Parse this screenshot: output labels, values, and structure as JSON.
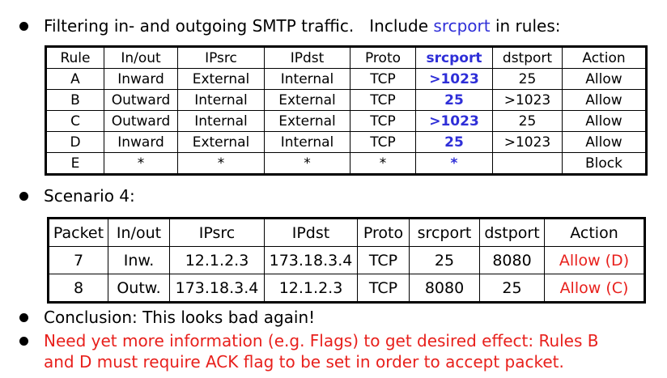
{
  "heading": {
    "text_before": "Filtering in- and outgoing SMTP traffic.   Include ",
    "accent": "srcport",
    "text_after": " in rules:"
  },
  "rules_table": {
    "headers": [
      "Rule",
      "In/out",
      "IPsrc",
      "IPdst",
      "Proto",
      "srcport",
      "dstport",
      "Action"
    ],
    "rows": [
      [
        "A",
        "Inward",
        "External",
        "Internal",
        "TCP",
        ">1023",
        "25",
        "Allow"
      ],
      [
        "B",
        "Outward",
        "Internal",
        "External",
        "TCP",
        "25",
        ">1023",
        "Allow"
      ],
      [
        "C",
        "Outward",
        "Internal",
        "External",
        "TCP",
        ">1023",
        "25",
        "Allow"
      ],
      [
        "D",
        "Inward",
        "External",
        "Internal",
        "TCP",
        "25",
        ">1023",
        "Allow"
      ],
      [
        "E",
        "*",
        "*",
        "*",
        "*",
        "*",
        "",
        "Block"
      ]
    ]
  },
  "scenario_label": "Scenario 4:",
  "scenario_table": {
    "headers": [
      "Packet",
      "In/out",
      "IPsrc",
      "IPdst",
      "Proto",
      "srcport",
      "dstport",
      "Action"
    ],
    "rows": [
      [
        "7",
        "Inw.",
        "12.1.2.3",
        "173.18.3.4",
        "TCP",
        "25",
        "8080",
        "Allow (D)"
      ],
      [
        "8",
        "Outw.",
        "173.18.3.4",
        "12.1.2.3",
        "TCP",
        "8080",
        "25",
        "Allow (C)"
      ]
    ]
  },
  "conclusion": "Conclusion: This looks bad again!",
  "note_line1": "Need yet more information (e.g. Flags) to get desired effect: Rules B",
  "note_line2": "and D must require ACK flag to be set in order to accept packet.",
  "colors": {
    "accent": "#2f2fd8",
    "warning": "#e8201c"
  }
}
